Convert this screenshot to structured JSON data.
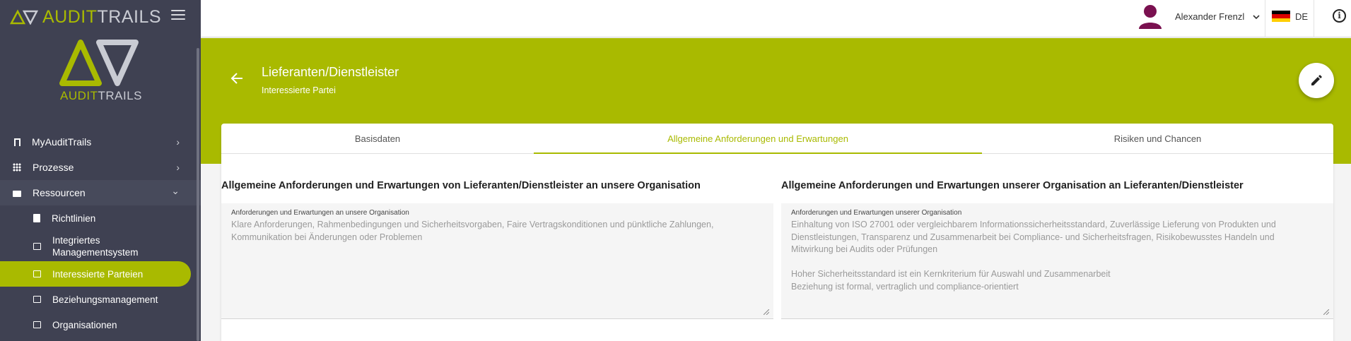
{
  "brand": {
    "part1": "AUDIT",
    "part2": "TRAILS"
  },
  "sidebar": {
    "items": [
      {
        "label": "MyAuditTrails",
        "icon": "bookmark-icon",
        "chevron": "›"
      },
      {
        "label": "Prozesse",
        "icon": "grid-icon",
        "chevron": "›"
      },
      {
        "label": "Ressourcen",
        "icon": "folder-icon",
        "chevron": "⌄"
      }
    ],
    "subitems": [
      {
        "label": "Richtlinien",
        "icon": "document-icon"
      },
      {
        "label": "Integriertes Managementsystem",
        "icon": "folder-document-icon"
      },
      {
        "label": "Interessierte Parteien",
        "icon": "folder-document-icon",
        "active": true
      },
      {
        "label": "Beziehungsmanagement",
        "icon": "folder-document-icon"
      },
      {
        "label": "Organisationen",
        "icon": "folder-document-icon"
      }
    ]
  },
  "header": {
    "user_name": "Alexander Frenzl",
    "language": "DE",
    "colors": {
      "accent": "#a9ba00",
      "avatar": "#7a1150"
    }
  },
  "page": {
    "title": "Lieferanten/Dienstleister",
    "subtitle": "Interessierte Partei"
  },
  "tabs": [
    {
      "label": "Basisdaten",
      "active": false
    },
    {
      "label": "Allgemeine Anforderungen und Erwartungen",
      "active": true
    },
    {
      "label": "Risiken und Chancen",
      "active": false
    }
  ],
  "left_section": {
    "title": "Allgemeine Anforderungen und Erwartungen von Lieferanten/Dienstleister an unsere Organisation",
    "field_label": "Anforderungen und Erwartungen an unsere Organisation",
    "field_value": "Klare Anforderungen, Rahmenbedingungen und Sicherheitsvorgaben, Faire Vertragskonditionen und pünktliche Zahlungen,\nKommunikation bei Änderungen oder Problemen"
  },
  "right_section": {
    "title": "Allgemeine Anforderungen und Erwartungen unserer Organisation an Lieferanten/Dienstleister",
    "field_label": "Anforderungen und Erwartungen unserer Organisation",
    "field_value": "Einhaltung von ISO 27001 oder vergleichbarem Informationssicherheitsstandard, Zuverlässige Lieferung von Produkten und\nDienstleistungen, Transparenz und Zusammenarbeit bei Compliance- und Sicherheitsfragen, Risikobewusstes Handeln und\nMitwirkung bei Audits oder Prüfungen\n\nHoher Sicherheitsstandard ist ein Kernkriterium für Auswahl und Zusammenarbeit\nBeziehung ist formal, vertraglich und compliance-orientiert"
  }
}
